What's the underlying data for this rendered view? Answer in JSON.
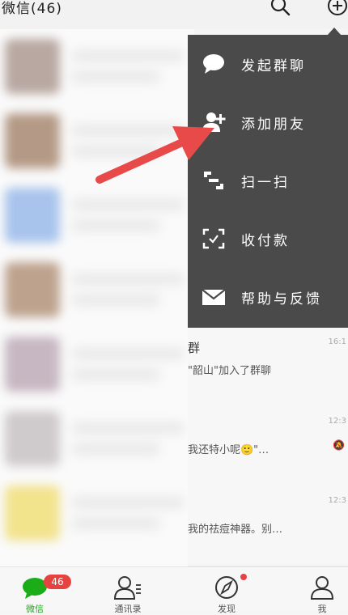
{
  "header": {
    "title": "微信(46)",
    "search_icon": "search-icon",
    "plus_icon": "plus-circle-icon"
  },
  "menu": {
    "items": [
      {
        "label": "发起群聊",
        "icon": "chat-bubble-icon"
      },
      {
        "label": "添加朋友",
        "icon": "add-friend-icon"
      },
      {
        "label": "扫一扫",
        "icon": "scan-icon"
      },
      {
        "label": "收付款",
        "icon": "payment-scan-icon"
      },
      {
        "label": "帮助与反馈",
        "icon": "mail-icon"
      }
    ]
  },
  "chats": [
    {
      "title": "群",
      "preview": "\"韶山\"加入了群聊",
      "time": "16:1"
    },
    {
      "title": "",
      "preview": "我还特小呢🙂\"…",
      "time": "12:3"
    },
    {
      "title": "",
      "preview": "我的祛痘神器。别…",
      "time": "12:3"
    }
  ],
  "tabbar": {
    "tabs": [
      {
        "label": "微信",
        "icon": "chat-icon",
        "badge": "46",
        "active": true
      },
      {
        "label": "通讯录",
        "icon": "contacts-icon"
      },
      {
        "label": "发现",
        "icon": "compass-icon"
      },
      {
        "label": "我",
        "icon": "person-icon"
      }
    ]
  },
  "colors": {
    "menu_bg": "#4a4a4a",
    "accent_green": "#1aad19",
    "badge_red": "#e64340",
    "arrow_red": "#e84a4a"
  }
}
